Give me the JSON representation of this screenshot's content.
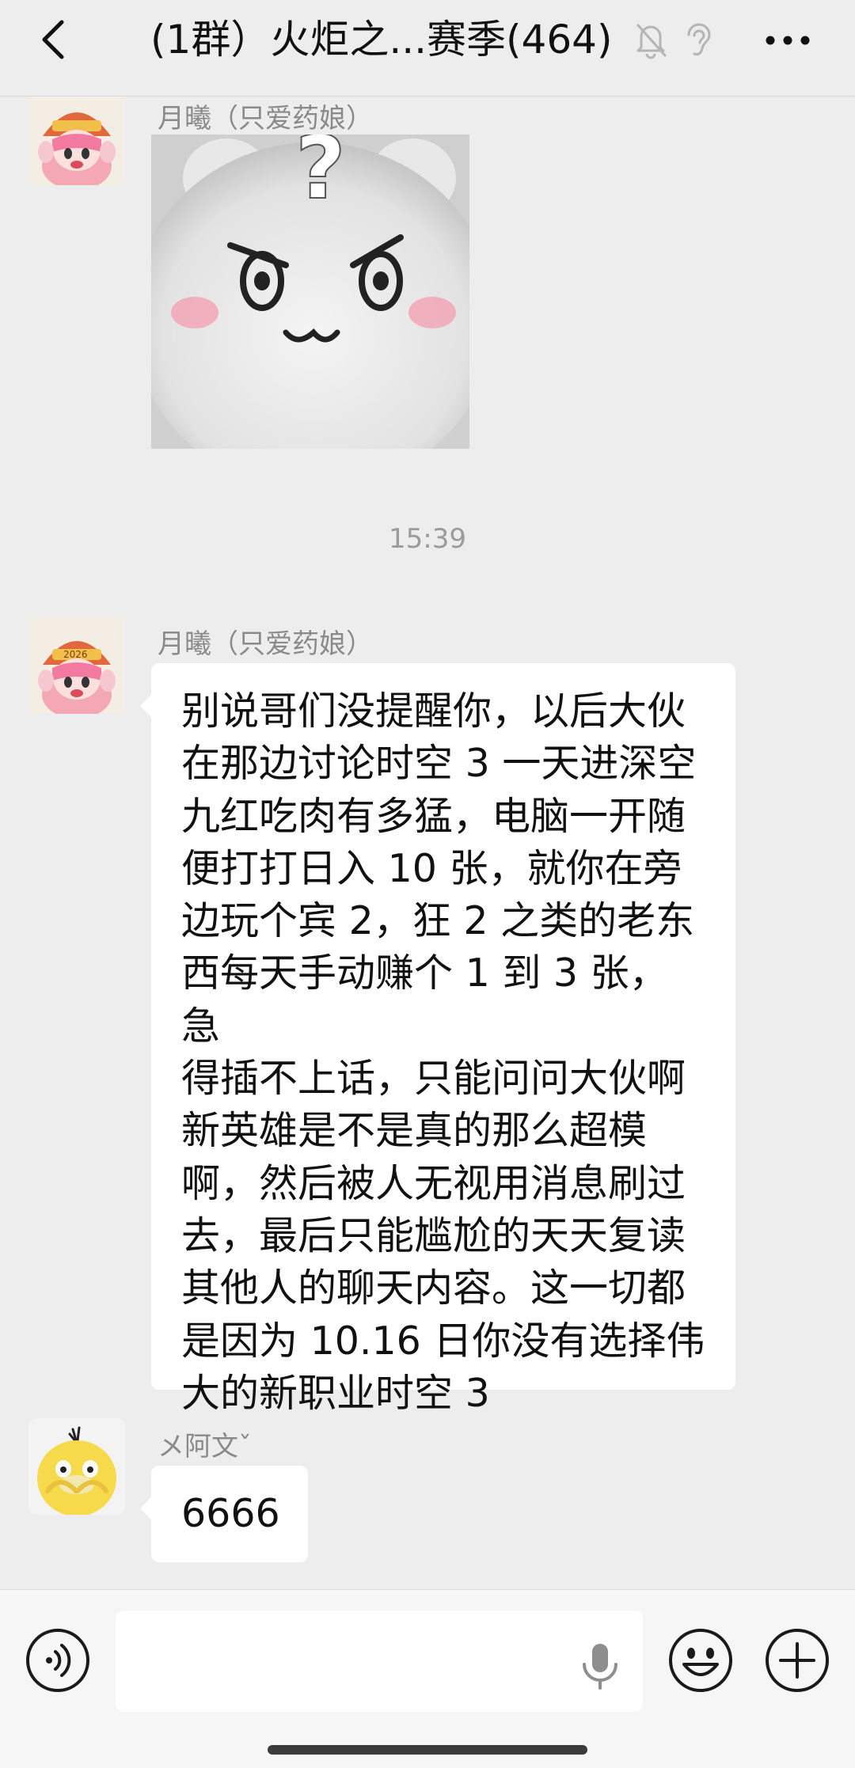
{
  "header": {
    "title": "(1群）火炬之...赛季(464)",
    "back_icon": "chevron-left-icon",
    "mute_icon": "bell-slash-icon",
    "earpiece_icon": "ear-icon",
    "more_icon": "ellipsis-icon"
  },
  "messages": [
    {
      "type": "sticker",
      "sender": "月曦（只爱药娘）",
      "avatar": "tiger-girl-avatar",
      "sticker": "white-bear-question-sticker",
      "sticker_text": "?"
    },
    {
      "type": "time",
      "text": "15:39"
    },
    {
      "type": "text",
      "sender": "月曦（只爱药娘）",
      "avatar": "tiger-girl-avatar",
      "avatar_text": "2026",
      "lines": [
        "别说哥们没提醒你，以后大伙",
        "在那边讨论时空 3 一天进深空",
        "九红吃肉有多猛，电脑一开随",
        "便打打日入 10 张，就你在旁",
        "边玩个宾 2，狂 2 之类的老东",
        "西每天手动赚个 1 到 3 张，急",
        "得插不上话，只能问问大伙啊",
        "新英雄是不是真的那么超模",
        "啊，然后被人无视用消息刷过",
        "去，最后只能尴尬的天天复读",
        "其他人的聊天内容。这一切都",
        "是因为 10.16 日你没有选择伟",
        "大的新职业时空 3"
      ]
    },
    {
      "type": "text",
      "sender": "メ阿文ˇ",
      "avatar": "yellow-duck-avatar",
      "text": "6666"
    }
  ],
  "inputbar": {
    "input_value": "",
    "voice_icon": "voice-wave-icon",
    "mic_icon": "microphone-icon",
    "emoji_icon": "smiley-icon",
    "plus_icon": "plus-circle-icon"
  },
  "colors": {
    "background": "#ededed",
    "bubble": "#ffffff",
    "name_gray": "#8a8a8a",
    "time_gray": "#9b9b9b"
  }
}
